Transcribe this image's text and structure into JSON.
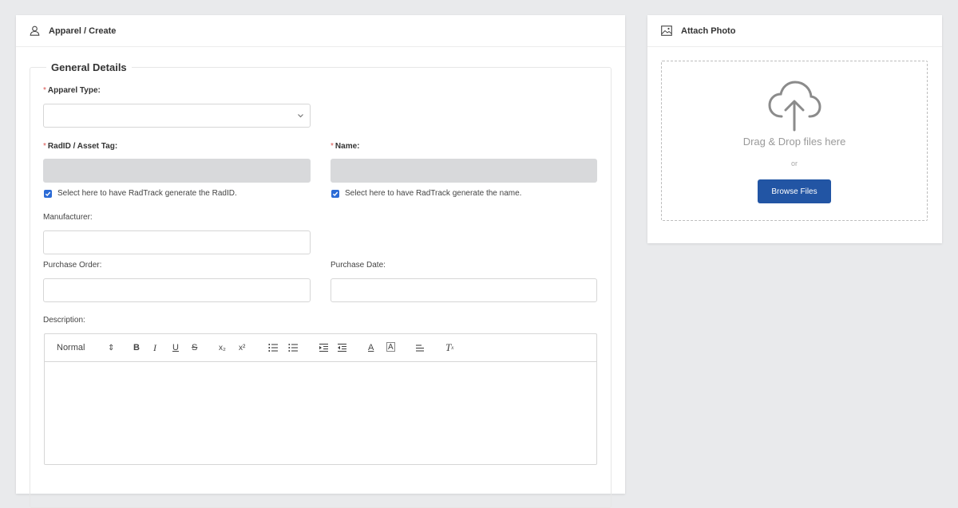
{
  "main_card": {
    "header_icon": "user-icon",
    "header_title": "Apparel / Create"
  },
  "general_details": {
    "legend": "General Details",
    "apparel_type": {
      "star": "*",
      "label": "Apparel Type:",
      "value": ""
    },
    "radid": {
      "star": "*",
      "label": "RadID / Asset Tag:",
      "value": "",
      "checkbox_label": "Select here to have RadTrack generate the RadID.",
      "checked": true
    },
    "name": {
      "star": "*",
      "label": "Name:",
      "value": "",
      "checkbox_label": "Select here to have RadTrack generate the name.",
      "checked": true
    },
    "manufacturer": {
      "label": "Manufacturer:",
      "value": ""
    },
    "purchase_order": {
      "label": "Purchase Order:",
      "value": ""
    },
    "purchase_date": {
      "label": "Purchase Date:",
      "value": ""
    },
    "description": {
      "label": "Description:",
      "value": ""
    }
  },
  "editor_toolbar": {
    "format_select": "Normal",
    "format_arrows": "⇕",
    "bold": "B",
    "italic": "I",
    "underline": "U",
    "strike": "S",
    "subscript": "x₂",
    "superscript": "x²",
    "ordered_list": "ordered-list-icon",
    "bullet_list": "bullet-list-icon",
    "indent": "indent-icon",
    "outdent": "outdent-icon",
    "text_color": "A",
    "background_color": "A",
    "align": "align-icon",
    "clean": "T"
  },
  "photo_card": {
    "header_icon": "image-icon",
    "header_title": "Attach Photo",
    "upload_icon": "cloud-upload-icon",
    "drop_text": "Drag & Drop files here",
    "or_text": "or",
    "browse_label": "Browse Files"
  },
  "colors": {
    "page_bg": "#e9eaec",
    "required": "#d9534f",
    "checkbox": "#2b6bd6",
    "primary_button": "#2255a4",
    "disabled_input": "#d8d9db"
  }
}
